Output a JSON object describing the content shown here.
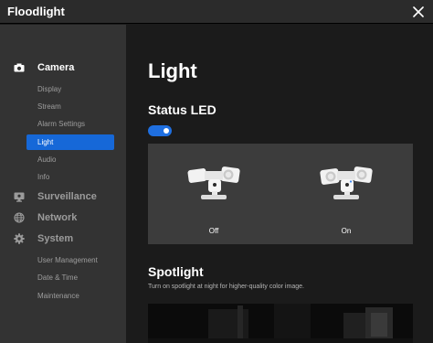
{
  "app": {
    "title": "Floodlight"
  },
  "sidebar": {
    "sections": [
      {
        "id": "camera",
        "label": "Camera",
        "icon": "camera-icon",
        "active": true,
        "items": [
          {
            "label": "Display"
          },
          {
            "label": "Stream"
          },
          {
            "label": "Alarm Settings"
          },
          {
            "label": "Light",
            "selected": true
          },
          {
            "label": "Audio"
          },
          {
            "label": "Info"
          }
        ]
      },
      {
        "id": "surveillance",
        "label": "Surveillance",
        "icon": "monitor-icon",
        "items": []
      },
      {
        "id": "network",
        "label": "Network",
        "icon": "globe-icon",
        "items": []
      },
      {
        "id": "system",
        "label": "System",
        "icon": "gear-icon",
        "items": [
          {
            "label": "User Management"
          },
          {
            "label": "Date & Time"
          },
          {
            "label": "Maintenance"
          }
        ]
      }
    ]
  },
  "main": {
    "page_title": "Light",
    "status_led": {
      "title": "Status LED",
      "toggle_on": true,
      "options": [
        {
          "label": "Off"
        },
        {
          "label": "On"
        }
      ]
    },
    "spotlight": {
      "title": "Spotlight",
      "description": "Turn on spotlight at night for higher-quality color image."
    }
  },
  "colors": {
    "accent": "#1668d8",
    "sidebar_bg": "#333333",
    "main_bg": "#1b1b1b",
    "panel_bg": "#3c3c3c"
  }
}
